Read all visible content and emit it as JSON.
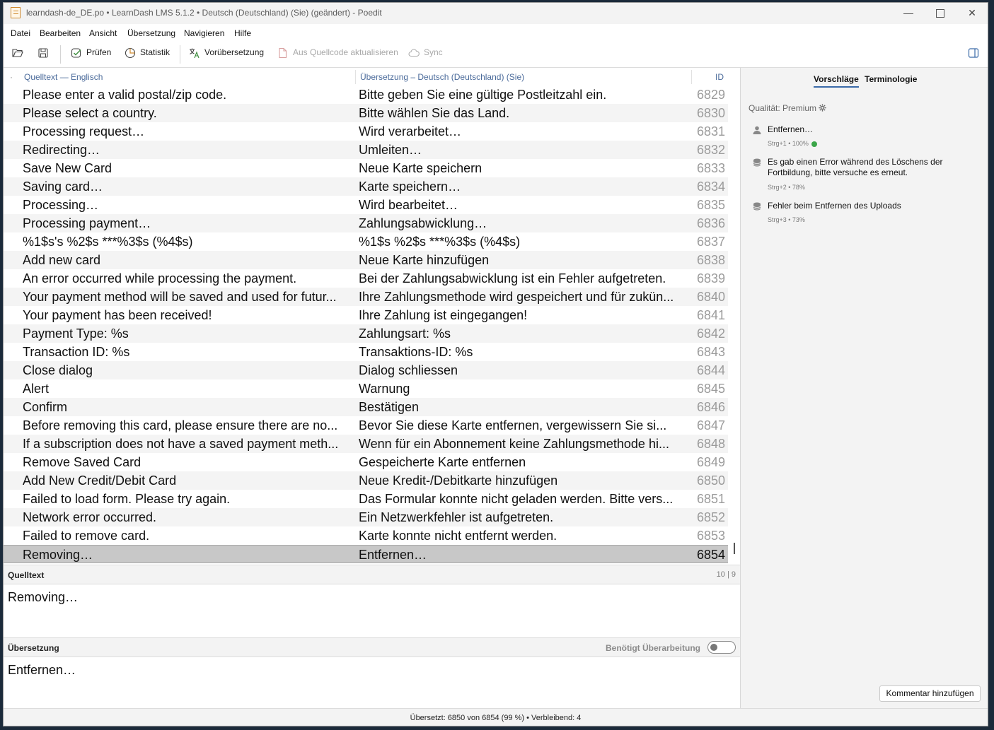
{
  "window": {
    "title": "learndash-de_DE.po • LearnDash LMS 5.1.2 • Deutsch (Deutschland) (Sie) (geändert) - Poedit",
    "minimize_glyph": "—",
    "close_glyph": "✕"
  },
  "menu": [
    "Datei",
    "Bearbeiten",
    "Ansicht",
    "Übersetzung",
    "Navigieren",
    "Hilfe"
  ],
  "toolbar": {
    "validate": "Prüfen",
    "statistics": "Statistik",
    "pretranslate": "Vorübersetzung",
    "update_from_source": "Aus Quellcode aktualisieren",
    "sync": "Sync"
  },
  "list": {
    "header_marker": "·",
    "header_source": "Quelltext — Englisch",
    "header_translation": "Übersetzung – Deutsch (Deutschland) (Sie)",
    "header_id": "ID",
    "rows": [
      {
        "source": "Please enter a valid postal/zip code.",
        "translation": "Bitte geben Sie eine gültige Postleitzahl ein.",
        "id": "6829"
      },
      {
        "source": "Please select a country.",
        "translation": "Bitte wählen Sie das Land.",
        "id": "6830"
      },
      {
        "source": "Processing request…",
        "translation": "Wird verarbeitet…",
        "id": "6831"
      },
      {
        "source": "Redirecting…",
        "translation": "Umleiten…",
        "id": "6832"
      },
      {
        "source": "Save New Card",
        "translation": "Neue Karte speichern",
        "id": "6833"
      },
      {
        "source": "Saving card…",
        "translation": "Karte speichern…",
        "id": "6834"
      },
      {
        "source": "Processing…",
        "translation": "Wird bearbeitet…",
        "id": "6835"
      },
      {
        "source": "Processing payment…",
        "translation": "Zahlungsabwicklung…",
        "id": "6836"
      },
      {
        "source": "%1$s's %2$s ***%3$s (%4$s)",
        "translation": "%1$s %2$s ***%3$s (%4$s)",
        "id": "6837"
      },
      {
        "source": "Add new card",
        "translation": "Neue Karte hinzufügen",
        "id": "6838"
      },
      {
        "source": "An error occurred while processing the payment.",
        "translation": "Bei der Zahlungsabwicklung ist ein Fehler aufgetreten.",
        "id": "6839"
      },
      {
        "source": "Your payment method will be saved and used for futur...",
        "translation": "Ihre Zahlungsmethode wird gespeichert und für zukün...",
        "id": "6840"
      },
      {
        "source": "Your payment has been received!",
        "translation": "Ihre Zahlung ist eingegangen!",
        "id": "6841"
      },
      {
        "source": "Payment Type: %s",
        "translation": "Zahlungsart: %s",
        "id": "6842"
      },
      {
        "source": "Transaction ID: %s",
        "translation": "Transaktions-ID: %s",
        "id": "6843"
      },
      {
        "source": "Close dialog",
        "translation": "Dialog schliessen",
        "id": "6844"
      },
      {
        "source": "Alert",
        "translation": "Warnung",
        "id": "6845"
      },
      {
        "source": "Confirm",
        "translation": "Bestätigen",
        "id": "6846"
      },
      {
        "source": "Before removing this card, please ensure there are no...",
        "translation": "Bevor Sie diese Karte entfernen, vergewissern Sie si...",
        "id": "6847"
      },
      {
        "source": "If a subscription does not have a saved payment meth...",
        "translation": "Wenn für ein Abonnement keine Zahlungsmethode hi...",
        "id": "6848"
      },
      {
        "source": "Remove Saved Card",
        "translation": "Gespeicherte Karte entfernen",
        "id": "6849"
      },
      {
        "source": "Add New Credit/Debit Card",
        "translation": "Neue Kredit-/Debitkarte hinzufügen",
        "id": "6850"
      },
      {
        "source": "Failed to load form. Please try again.",
        "translation": "Das Formular konnte nicht geladen werden. Bitte vers...",
        "id": "6851"
      },
      {
        "source": "Network error occurred.",
        "translation": "Ein Netzwerkfehler ist aufgetreten.",
        "id": "6852"
      },
      {
        "source": "Failed to remove card.",
        "translation": "Karte konnte nicht entfernt werden.",
        "id": "6853"
      },
      {
        "source": "Removing…",
        "translation": "Entfernen…",
        "id": "6854"
      }
    ]
  },
  "source_editor": {
    "title": "Quelltext",
    "counts": "10 | 9",
    "text": "Removing…"
  },
  "translation_editor": {
    "title": "Übersetzung",
    "needs_work_label": "Benötigt Überarbeitung",
    "needs_work": false,
    "text": "Entfernen…"
  },
  "sidepanel": {
    "tab_suggestions": "Vorschläge",
    "tab_terminology": "Terminologie",
    "quality": "Qualität: Premium",
    "suggestions": [
      {
        "text": "Entfernen…",
        "meta": "Strg+1 • 100%",
        "icon": "person-icon",
        "exact": true
      },
      {
        "text": "Es gab einen Error während des Löschens der Fortbildung, bitte versuche es erneut.",
        "meta": "Strg+2 • 78%",
        "icon": "database-icon",
        "exact": false
      },
      {
        "text": "Fehler beim Entfernen des Uploads",
        "meta": "Strg+3 • 73%",
        "icon": "database-icon",
        "exact": false
      }
    ],
    "add_comment": "Kommentar hinzufügen"
  },
  "status": {
    "text": "Übersetzt: 6850 von 6854 (99 %)  •  Verbleibend: 4"
  },
  "colors": {
    "accent": "#3a6aa8",
    "header_text": "#4a6a9a",
    "selected_row": "#c8c8c8",
    "ok_green": "#3aa548"
  }
}
